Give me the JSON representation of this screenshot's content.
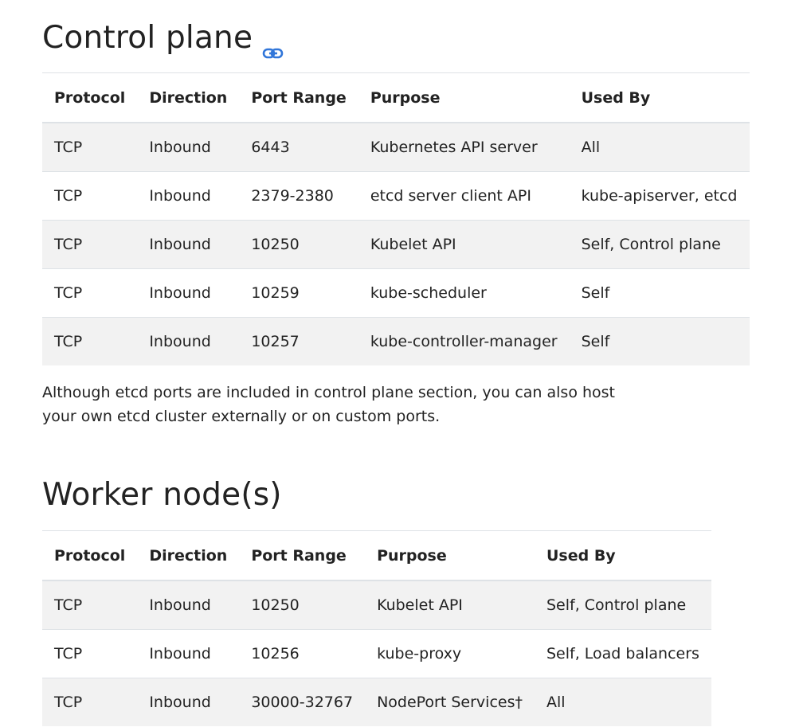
{
  "control_plane": {
    "heading": "Control plane",
    "anchor_icon": "link-icon",
    "accent": "#3176d9",
    "columns": [
      "Protocol",
      "Direction",
      "Port Range",
      "Purpose",
      "Used By"
    ],
    "rows": [
      [
        "TCP",
        "Inbound",
        "6443",
        "Kubernetes API server",
        "All"
      ],
      [
        "TCP",
        "Inbound",
        "2379-2380",
        "etcd server client API",
        "kube-apiserver, etcd"
      ],
      [
        "TCP",
        "Inbound",
        "10250",
        "Kubelet API",
        "Self, Control plane"
      ],
      [
        "TCP",
        "Inbound",
        "10259",
        "kube-scheduler",
        "Self"
      ],
      [
        "TCP",
        "Inbound",
        "10257",
        "kube-controller-manager",
        "Self"
      ]
    ],
    "note": "Although etcd ports are included in control plane section, you can also host your own etcd cluster externally or on custom ports."
  },
  "worker_nodes": {
    "heading": "Worker node(s)",
    "columns": [
      "Protocol",
      "Direction",
      "Port Range",
      "Purpose",
      "Used By"
    ],
    "rows": [
      [
        "TCP",
        "Inbound",
        "10250",
        "Kubelet API",
        "Self, Control plane"
      ],
      [
        "TCP",
        "Inbound",
        "10256",
        "kube-proxy",
        "Self, Load balancers"
      ],
      [
        "TCP",
        "Inbound",
        "30000-32767",
        "NodePort Services†",
        "All"
      ]
    ]
  }
}
